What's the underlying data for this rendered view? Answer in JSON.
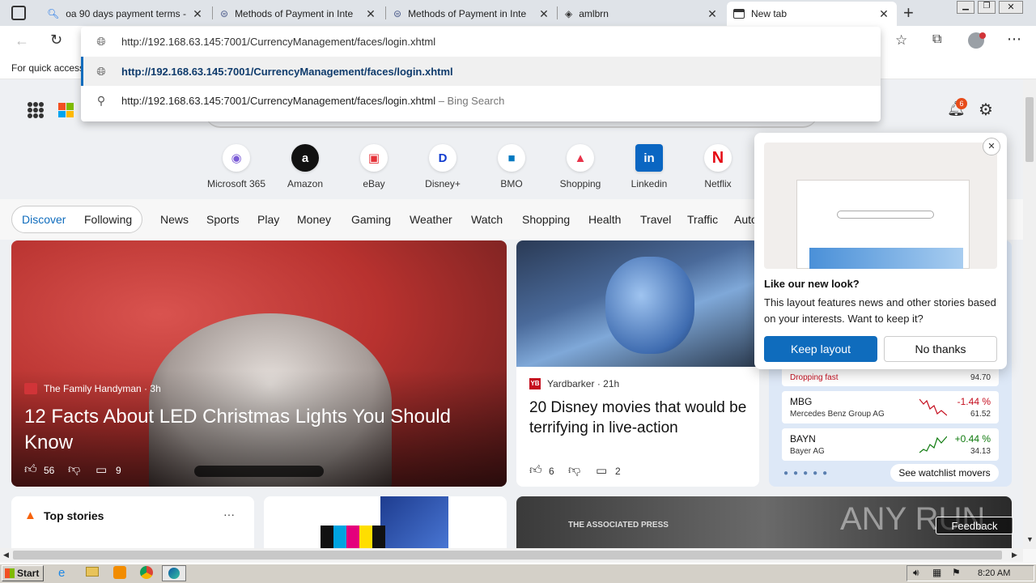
{
  "tabs": [
    {
      "title": "oa 90 days payment terms -",
      "icon": "search-icon"
    },
    {
      "title": "Methods of Payment in Inte",
      "icon": "page-icon"
    },
    {
      "title": "Methods of Payment in Inte",
      "icon": "page-icon"
    },
    {
      "title": "amlbrn",
      "icon": "page-icon"
    },
    {
      "title": "New tab",
      "icon": "newtab-icon"
    }
  ],
  "toolbar": {
    "address_value": "http://192.168.63.145:7001/CurrencyManagement/faces/login.xhtml",
    "favorites_hint": "For quick access"
  },
  "omnibox": {
    "suggestion_url": "http://192.168.63.145:7001/CurrencyManagement/faces/login.xhtml",
    "search_text": "http://192.168.63.145:7001/CurrencyManagement/faces/login.xhtml",
    "search_suffix": " – Bing Search"
  },
  "header": {
    "notif_count": "6"
  },
  "quicklinks": [
    {
      "label": "Microsoft 365",
      "glyph": "◉",
      "color": "#7b5cd6"
    },
    {
      "label": "Amazon",
      "glyph": "a",
      "color": "#111111"
    },
    {
      "label": "eBay",
      "glyph": "▣",
      "color": "#e53238"
    },
    {
      "label": "Disney+",
      "glyph": "D",
      "color": "#113ccf"
    },
    {
      "label": "BMO",
      "glyph": "■",
      "color": "#0079c1"
    },
    {
      "label": "Shopping",
      "glyph": "▲",
      "color": "#e8334a"
    },
    {
      "label": "Linkedin",
      "glyph": "in",
      "color": "#0a66c2"
    },
    {
      "label": "Netflix",
      "glyph": "N",
      "color": "#e50914"
    }
  ],
  "feed_nav": {
    "discover": "Discover",
    "following": "Following",
    "items": [
      "News",
      "Sports",
      "Play",
      "Money",
      "Gaming",
      "Weather",
      "Watch",
      "Shopping",
      "Health",
      "Travel",
      "Traffic",
      "Auto"
    ]
  },
  "hero": {
    "source": "The Family Handyman",
    "age": "3h",
    "headline": "12 Facts About LED Christmas Lights You Should Know",
    "likes": "56",
    "comments": "9"
  },
  "story2": {
    "source": "Yardbarker",
    "age": "21h",
    "headline": "20 Disney movies that would be terrifying in live-action",
    "likes": "6",
    "comments": "2"
  },
  "stocks": [
    {
      "symbol": "",
      "name": "Dropping fast",
      "change": "",
      "price": "94.70",
      "color": "#c50f1f"
    },
    {
      "symbol": "MBG",
      "name": "Mercedes Benz Group AG",
      "change": "-1.44 %",
      "price": "61.52",
      "color": "#c50f1f"
    },
    {
      "symbol": "BAYN",
      "name": "Bayer AG",
      "change": "+0.44 %",
      "price": "34.13",
      "color": "#0e7a0d"
    }
  ],
  "watchlist_button": "See watchlist movers",
  "popup": {
    "title": "Like our new look?",
    "body": "This layout features news and other stories based on your interests. Want to keep it?",
    "keep": "Keep layout",
    "no": "No thanks"
  },
  "top_stories": {
    "title": "Top stories",
    "more": "···"
  },
  "ap_label": "THE ASSOCIATED PRESS",
  "feedback": "Feedback",
  "watermark": "ANY RUN",
  "taskbar": {
    "start": "Start",
    "time": "8:20 AM"
  }
}
